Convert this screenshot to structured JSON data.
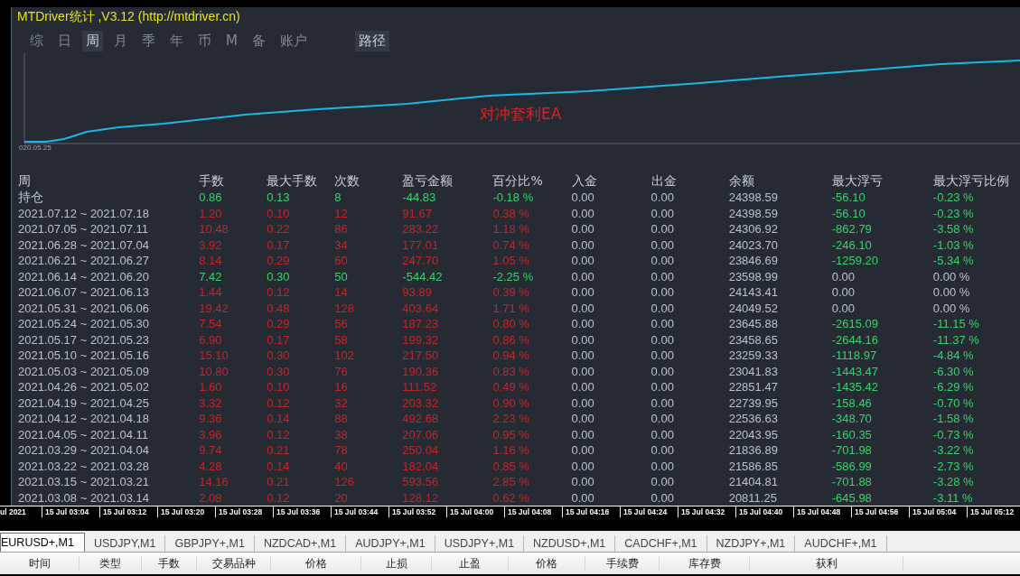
{
  "title": "MTDriver统计 ,V3.12 (http://mtdriver.cn)",
  "tabs": [
    {
      "label": "综",
      "selected": false
    },
    {
      "label": "日",
      "selected": false
    },
    {
      "label": "周",
      "selected": true
    },
    {
      "label": "月",
      "selected": false
    },
    {
      "label": "季",
      "selected": false
    },
    {
      "label": "年",
      "selected": false
    },
    {
      "label": "币",
      "selected": false
    },
    {
      "label": "M",
      "selected": false
    },
    {
      "label": "备",
      "selected": false
    },
    {
      "label": "账户",
      "selected": false
    }
  ],
  "path_button": "路径",
  "chart": {
    "caption": "对冲套利EA",
    "start_date": "020.05.25"
  },
  "table": {
    "columns": [
      "周",
      "手数",
      "最大手数",
      "次数",
      "盈亏金额",
      "百分比%",
      "入金",
      "出金",
      "余额",
      "最大浮亏",
      "最大浮亏比例"
    ],
    "rows": [
      {
        "color": "#37d36e",
        "float_loss": true,
        "cells": [
          "持仓",
          "0.86",
          "0.13",
          "8",
          "-44.83",
          "-0.18 %",
          "0.00",
          "0.00",
          "24398.59",
          "-56.10",
          "-0.23 %"
        ]
      },
      {
        "color": "#c4252b",
        "float_loss": true,
        "cells": [
          "2021.07.12 ~ 2021.07.18",
          "1.20",
          "0.10",
          "12",
          "91.67",
          "0.38 %",
          "0.00",
          "0.00",
          "24398.59",
          "-56.10",
          "-0.23 %"
        ]
      },
      {
        "color": "#c4252b",
        "float_loss": true,
        "cells": [
          "2021.07.05 ~ 2021.07.11",
          "10.48",
          "0.22",
          "86",
          "283.22",
          "1.18 %",
          "0.00",
          "0.00",
          "24306.92",
          "-862.79",
          "-3.58 %"
        ]
      },
      {
        "color": "#c4252b",
        "float_loss": true,
        "cells": [
          "2021.06.28 ~ 2021.07.04",
          "3.92",
          "0.17",
          "34",
          "177.01",
          "0.74 %",
          "0.00",
          "0.00",
          "24023.70",
          "-246.10",
          "-1.03 %"
        ]
      },
      {
        "color": "#c4252b",
        "float_loss": true,
        "cells": [
          "2021.06.21 ~ 2021.06.27",
          "8.14",
          "0.29",
          "60",
          "247.70",
          "1.05 %",
          "0.00",
          "0.00",
          "23846.69",
          "-1259.20",
          "-5.34 %"
        ]
      },
      {
        "color": "#37d36e",
        "float_loss": false,
        "cells": [
          "2021.06.14 ~ 2021.06.20",
          "7.42",
          "0.30",
          "50",
          "-544.42",
          "-2.25 %",
          "0.00",
          "0.00",
          "23598.99",
          "0.00",
          "0.00 %"
        ]
      },
      {
        "color": "#c4252b",
        "float_loss": false,
        "cells": [
          "2021.06.07 ~ 2021.06.13",
          "1.44",
          "0.12",
          "14",
          "93.89",
          "0.39 %",
          "0.00",
          "0.00",
          "24143.41",
          "0.00",
          "0.00 %"
        ]
      },
      {
        "color": "#c4252b",
        "float_loss": false,
        "cells": [
          "2021.05.31 ~ 2021.06.06",
          "19.42",
          "0.48",
          "128",
          "403.64",
          "1.71 %",
          "0.00",
          "0.00",
          "24049.52",
          "0.00",
          "0.00 %"
        ]
      },
      {
        "color": "#c4252b",
        "float_loss": true,
        "cells": [
          "2021.05.24 ~ 2021.05.30",
          "7.54",
          "0.29",
          "56",
          "187.23",
          "0.80 %",
          "0.00",
          "0.00",
          "23645.88",
          "-2615.09",
          "-11.15 %"
        ]
      },
      {
        "color": "#c4252b",
        "float_loss": true,
        "cells": [
          "2021.05.17 ~ 2021.05.23",
          "6.90",
          "0.17",
          "58",
          "199.32",
          "0.86 %",
          "0.00",
          "0.00",
          "23458.65",
          "-2644.16",
          "-11.37 %"
        ]
      },
      {
        "color": "#c4252b",
        "float_loss": true,
        "cells": [
          "2021.05.10 ~ 2021.05.16",
          "15.10",
          "0.30",
          "102",
          "217.50",
          "0.94 %",
          "0.00",
          "0.00",
          "23259.33",
          "-1118.97",
          "-4.84 %"
        ]
      },
      {
        "color": "#c4252b",
        "float_loss": true,
        "cells": [
          "2021.05.03 ~ 2021.05.09",
          "10.80",
          "0.30",
          "76",
          "190.36",
          "0.83 %",
          "0.00",
          "0.00",
          "23041.83",
          "-1443.47",
          "-6.30 %"
        ]
      },
      {
        "color": "#c4252b",
        "float_loss": true,
        "cells": [
          "2021.04.26 ~ 2021.05.02",
          "1.60",
          "0.10",
          "16",
          "111.52",
          "0.49 %",
          "0.00",
          "0.00",
          "22851.47",
          "-1435.42",
          "-6.29 %"
        ]
      },
      {
        "color": "#c4252b",
        "float_loss": true,
        "cells": [
          "2021.04.19 ~ 2021.04.25",
          "3.32",
          "0.12",
          "32",
          "203.32",
          "0.90 %",
          "0.00",
          "0.00",
          "22739.95",
          "-158.46",
          "-0.70 %"
        ]
      },
      {
        "color": "#c4252b",
        "float_loss": true,
        "cells": [
          "2021.04.12 ~ 2021.04.18",
          "9.36",
          "0.14",
          "88",
          "492.68",
          "2.23 %",
          "0.00",
          "0.00",
          "22536.63",
          "-348.70",
          "-1.58 %"
        ]
      },
      {
        "color": "#c4252b",
        "float_loss": true,
        "cells": [
          "2021.04.05 ~ 2021.04.11",
          "3.96",
          "0.12",
          "38",
          "207.06",
          "0.95 %",
          "0.00",
          "0.00",
          "22043.95",
          "-160.35",
          "-0.73 %"
        ]
      },
      {
        "color": "#c4252b",
        "float_loss": true,
        "cells": [
          "2021.03.29 ~ 2021.04.04",
          "9.74",
          "0.21",
          "78",
          "250.04",
          "1.16 %",
          "0.00",
          "0.00",
          "21836.89",
          "-701.98",
          "-3.22 %"
        ]
      },
      {
        "color": "#c4252b",
        "float_loss": true,
        "cells": [
          "2021.03.22 ~ 2021.03.28",
          "4.28",
          "0.14",
          "40",
          "182.04",
          "0.85 %",
          "0.00",
          "0.00",
          "21586.85",
          "-586.99",
          "-2.73 %"
        ]
      },
      {
        "color": "#c4252b",
        "float_loss": true,
        "cells": [
          "2021.03.15 ~ 2021.03.21",
          "14.16",
          "0.21",
          "126",
          "593.56",
          "2.85 %",
          "0.00",
          "0.00",
          "21404.81",
          "-701.88",
          "-3.28 %"
        ]
      },
      {
        "color": "#c4252b",
        "float_loss": true,
        "cells": [
          "2021.03.08 ~ 2021.03.14",
          "2.08",
          "0.12",
          "20",
          "128.12",
          "0.62 %",
          "0.00",
          "0.00",
          "20811.25",
          "-645.98",
          "-3.11 %"
        ]
      }
    ]
  },
  "time_axis": [
    "ul 2021",
    "15 Jul 03:04",
    "15 Jul 03:12",
    "15 Jul 03:20",
    "15 Jul 03:28",
    "15 Jul 03:36",
    "15 Jul 03:44",
    "15 Jul 03:52",
    "15 Jul 04:00",
    "15 Jul 04:08",
    "15 Jul 04:16",
    "15 Jul 04:24",
    "15 Jul 04:32",
    "15 Jul 04:40",
    "15 Jul 04:48",
    "15 Jul 04:56",
    "15 Jul 05:04",
    "15 Jul 05:12"
  ],
  "chart_tabs": [
    {
      "label": "EURUSD+,M1",
      "selected": true
    },
    {
      "label": "USDJPY,M1",
      "selected": false
    },
    {
      "label": "GBPJPY+,M1",
      "selected": false
    },
    {
      "label": "NZDCAD+,M1",
      "selected": false
    },
    {
      "label": "AUDJPY+,M1",
      "selected": false
    },
    {
      "label": "USDJPY+,M1",
      "selected": false
    },
    {
      "label": "NZDUSD+,M1",
      "selected": false
    },
    {
      "label": "CADCHF+,M1",
      "selected": false
    },
    {
      "label": "NZDJPY+,M1",
      "selected": false
    },
    {
      "label": "AUDCHF+,M1",
      "selected": false
    }
  ],
  "order_columns": [
    "时间",
    "类型",
    "手数",
    "交易品种",
    "价格",
    "止损",
    "止盈",
    "价格",
    "手续费",
    "库存费",
    "获利"
  ]
}
